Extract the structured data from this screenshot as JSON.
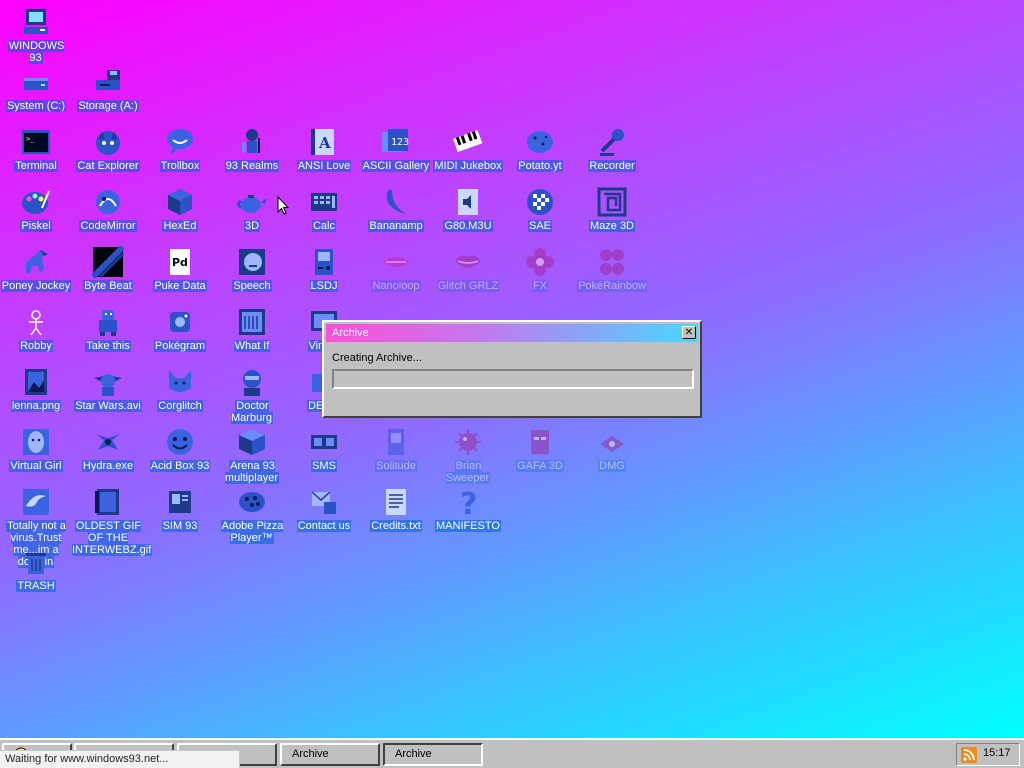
{
  "desktop": {
    "icons": [
      {
        "label": "WINDOWS 93",
        "icon": "computer-icon"
      },
      {
        "label": "System (C:)",
        "icon": "drive-icon"
      },
      {
        "label": "Storage (A:)",
        "icon": "floppy-drive-icon"
      },
      {
        "label": "Terminal",
        "icon": "terminal-icon"
      },
      {
        "label": "Cat Explorer",
        "icon": "cat-globe-icon"
      },
      {
        "label": "Trollbox",
        "icon": "chat-bubble-icon"
      },
      {
        "label": "93 Realms",
        "icon": "knight-icon"
      },
      {
        "label": "ANSI Love",
        "icon": "ansi-letter-icon"
      },
      {
        "label": "ASCII Gallery",
        "icon": "ascii-gallery-icon"
      },
      {
        "label": "MIDI Jukebox",
        "icon": "piano-keys-icon"
      },
      {
        "label": "Potato.yt",
        "icon": "potato-icon"
      },
      {
        "label": "Recorder",
        "icon": "microphone-icon"
      },
      {
        "label": "Piskel",
        "icon": "palette-icon"
      },
      {
        "label": "CodeMirror",
        "icon": "codemirror-icon"
      },
      {
        "label": "HexEd",
        "icon": "hex-cube-icon"
      },
      {
        "label": "3D",
        "icon": "teapot-icon"
      },
      {
        "label": "Calc",
        "icon": "calculator-icon"
      },
      {
        "label": "Bananamp",
        "icon": "banana-icon"
      },
      {
        "label": "G80.M3U",
        "icon": "audio-file-icon"
      },
      {
        "label": "SAE",
        "icon": "checker-ball-icon"
      },
      {
        "label": "Maze 3D",
        "icon": "maze-icon"
      },
      {
        "label": "Poney Jockey",
        "icon": "pony-icon"
      },
      {
        "label": "Byte Beat",
        "icon": "byte-beat-icon"
      },
      {
        "label": "Puke Data",
        "icon": "puke-data-icon"
      },
      {
        "label": "Speech",
        "icon": "speech-face-icon"
      },
      {
        "label": "LSDJ",
        "icon": "gameboy-icon"
      },
      {
        "label": "Nanoloop",
        "icon": "nanoloop-icon"
      },
      {
        "label": "Glitch GRLZ",
        "icon": "lips-icon"
      },
      {
        "label": "FX",
        "icon": "fx-flower-icon"
      },
      {
        "label": "PokéRainbow",
        "icon": "pokerainbow-icon"
      },
      {
        "label": "Robby",
        "icon": "stick-figure-icon"
      },
      {
        "label": "Take this",
        "icon": "robot-icon"
      },
      {
        "label": "Pokégram",
        "icon": "pokegram-icon"
      },
      {
        "label": "What If",
        "icon": "notebook-icon"
      },
      {
        "label": "Virtual",
        "icon": "virtual-pc-icon"
      },
      {
        "label": "lenna.png",
        "icon": "image-file-icon"
      },
      {
        "label": "Star Wars.avi",
        "icon": "yoda-icon"
      },
      {
        "label": "Corglitch",
        "icon": "corgi-icon"
      },
      {
        "label": "Doctor Marburg",
        "icon": "doctor-icon"
      },
      {
        "label": "DERG",
        "icon": "derg-icon"
      },
      {
        "label": "Virtual Girl",
        "icon": "girl-face-icon"
      },
      {
        "label": "Hydra.exe",
        "icon": "hydra-icon"
      },
      {
        "label": "Acid Box 93",
        "icon": "smiley-icon"
      },
      {
        "label": "Arena 93 multiplayer",
        "icon": "arena-cube-icon"
      },
      {
        "label": "SMS",
        "icon": "sms-icon"
      },
      {
        "label": "Solitude",
        "icon": "solitude-icon"
      },
      {
        "label": "Brian Sweeper",
        "icon": "mine-icon"
      },
      {
        "label": "GAFA 3D",
        "icon": "gafa-face-icon"
      },
      {
        "label": "DMG",
        "icon": "dmg-icon"
      },
      {
        "label": "Totally not a virus.Trust me...im a dolphin",
        "icon": "dolphin-icon"
      },
      {
        "label": "OLDEST GIF OF THE INTERWEBZ.gif",
        "icon": "gif-file-icon"
      },
      {
        "label": "SIM 93",
        "icon": "sim-card-icon"
      },
      {
        "label": "Adobe Pizza Player™",
        "icon": "pizza-icon"
      },
      {
        "label": "Contact us",
        "icon": "contact-icon"
      },
      {
        "label": "Credits.txt",
        "icon": "text-file-icon"
      },
      {
        "label": "MANIFESTO",
        "icon": "question-mark-icon"
      },
      {
        "label": "TRASH",
        "icon": "trash-icon"
      }
    ]
  },
  "dialog": {
    "title": "Archive",
    "close_glyph": "✕",
    "status": "Creating Archive...",
    "progress": 0
  },
  "taskbar": {
    "buttons": [
      {
        "label": ""
      },
      {
        "label": ""
      },
      {
        "label": ""
      },
      {
        "label": "Archive"
      },
      {
        "label": "Archive"
      }
    ],
    "clock": "15:17",
    "tray_icon": "rss-icon"
  },
  "status_bar": {
    "text": "Waiting for www.windows93.net..."
  },
  "colors": {
    "bg_top_left": "#ff00ff",
    "bg_bottom_right": "#00ffff",
    "label_highlight": "#1f64d2",
    "window_face": "#c0c0c0",
    "title_gradient_start": "#ff4fd8",
    "title_gradient_end": "#48d8ff"
  }
}
